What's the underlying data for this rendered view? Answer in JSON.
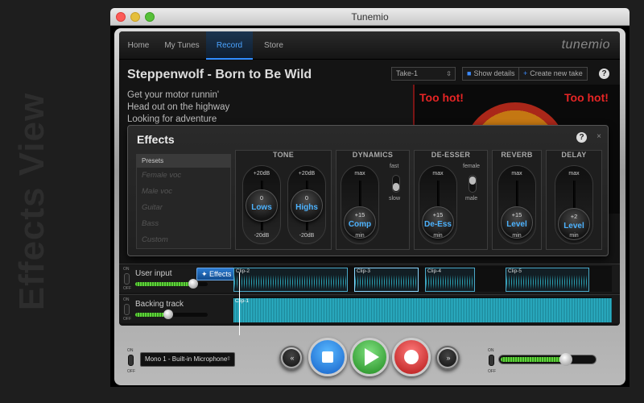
{
  "side_title": "Effects View",
  "window": {
    "title": "Tunemio"
  },
  "nav": {
    "tabs": [
      {
        "label": "Home"
      },
      {
        "label": "My Tunes"
      },
      {
        "label": "Record"
      },
      {
        "label": "Store"
      }
    ],
    "active_tab": "Record",
    "brand": "tunemio"
  },
  "song": {
    "title": "Steppenwolf - Born to Be Wild",
    "take": "Take-1",
    "show_details": "Show details",
    "create_take": "Create new take",
    "help": "?",
    "lyrics": [
      "Get your motor runnin'",
      "Head out on the highway",
      "Looking for adventure"
    ],
    "video_text": "Too hot!"
  },
  "effects": {
    "title": "Effects",
    "help": "?",
    "close": "×",
    "presets": {
      "header": "Presets",
      "items": [
        "Female voc",
        "Male voc",
        "Guitar",
        "Bass",
        "Custom"
      ]
    },
    "tone": {
      "title": "TONE",
      "knobs": [
        {
          "name": "Lows",
          "value": "0",
          "top": "+20dB",
          "bottom": "-20dB"
        },
        {
          "name": "Highs",
          "value": "0",
          "top": "+20dB",
          "bottom": "-20dB"
        }
      ]
    },
    "dynamics": {
      "title": "DYNAMICS",
      "knob": {
        "name": "Comp",
        "value": "+15",
        "top": "max",
        "bottom": "min"
      },
      "toggle_top": "fast",
      "toggle_bottom": "slow"
    },
    "deesser": {
      "title": "DE-ESSER",
      "knob": {
        "name": "De-Ess",
        "value": "+15",
        "top": "max",
        "bottom": "min"
      },
      "toggle_top": "female",
      "toggle_bottom": "male"
    },
    "reverb": {
      "title": "REVERB",
      "knob": {
        "name": "Level",
        "value": "+15",
        "top": "max",
        "bottom": "min"
      }
    },
    "delay": {
      "title": "DELAY",
      "knob": {
        "name": "Level",
        "value": "+2",
        "top": "max",
        "bottom": "min"
      }
    }
  },
  "tracks": {
    "user_input": {
      "name": "User input",
      "effects_button": "Effects",
      "on": "ON",
      "off": "OFF",
      "volume": 0.8,
      "clips": [
        "Clip-2",
        "Clip-3",
        "Clip-4",
        "Clip-5"
      ]
    },
    "backing": {
      "name": "Backing track",
      "on": "ON",
      "off": "OFF",
      "volume": 0.45,
      "clip": "Clip-1"
    }
  },
  "transport": {
    "input_device": "Mono 1 - Built-in Microphone",
    "on": "ON",
    "off": "OFF",
    "rewind_icon": "«",
    "forward_icon": "»",
    "master_volume": 0.7
  },
  "colors": {
    "accent": "#4db3ff",
    "wave": "#2fb4c7",
    "record": "#d01a1a",
    "play": "#2a9a2a",
    "stop": "#1e74d8"
  }
}
